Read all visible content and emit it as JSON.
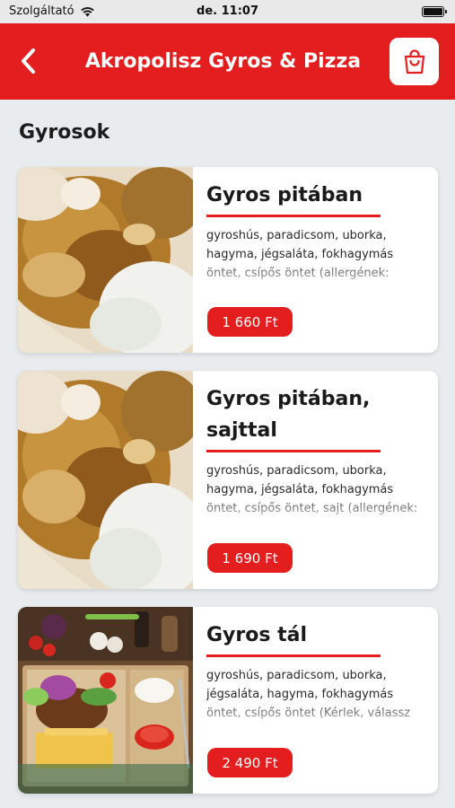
{
  "status_bar": {
    "carrier": "Szolgáltató",
    "time": "de. 11:07"
  },
  "header": {
    "title": "Akropolisz Gyros & Pizza",
    "back_icon": "chevron-left-icon",
    "cart_icon": "shopping-bag-icon"
  },
  "section": {
    "title": "Gyrosok"
  },
  "products": [
    {
      "name": "Gyros pitában",
      "description": "gyroshús, paradicsom, uborka, hagyma, jégsaláta, fokhagymás öntet, csípős öntet (allergének: glutén)",
      "price": "1 660 Ft"
    },
    {
      "name": "Gyros pitában, sajttal",
      "description": "gyroshús, paradicsom, uborka, hagyma, jégsaláta, fokhagymás öntet, csípős öntet, sajt (allergének: g",
      "price": "1 690 Ft"
    },
    {
      "name": "Gyros tál",
      "description": "gyroshús, paradicsom, uborka, jégsaláta, hagyma, fokhagymás öntet, csípős öntet (Kérlek, válassz hoz",
      "price": "2 490 Ft"
    }
  ],
  "colors": {
    "accent": "#e41e1e",
    "background": "#e9ecef",
    "card": "#ffffff"
  }
}
